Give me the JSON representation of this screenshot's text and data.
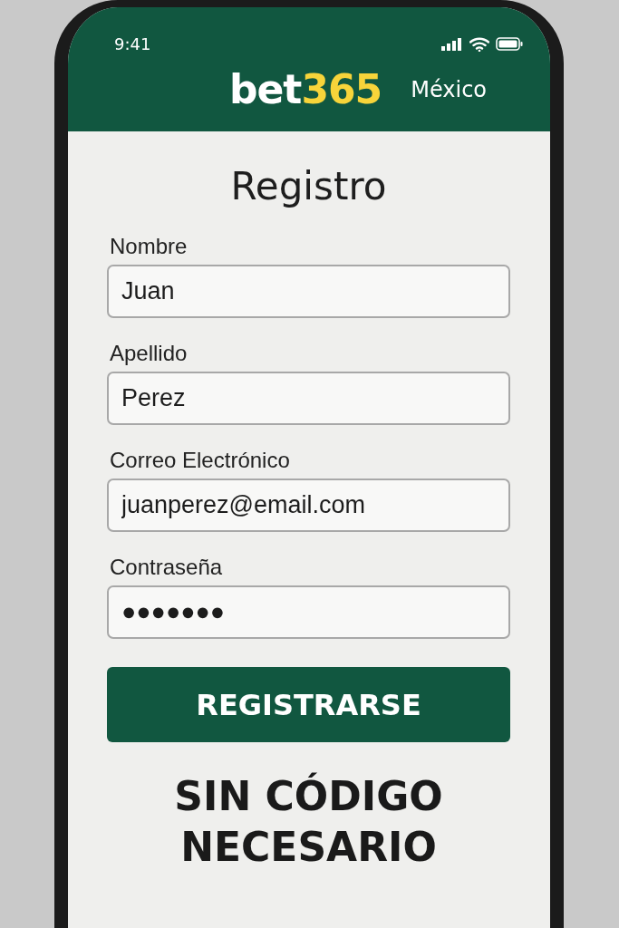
{
  "status_bar": {
    "time": "9:41"
  },
  "header": {
    "logo": {
      "main": "bet",
      "accent": "365"
    },
    "region": "México"
  },
  "form": {
    "title": "Registro",
    "fields": [
      {
        "label": "Nombre",
        "value": "Juan"
      },
      {
        "label": "Apellido",
        "value": "Perez"
      },
      {
        "label": "Correo Electrónico",
        "value": "juanperez@email.com"
      },
      {
        "label": "Contraseña",
        "value": "●●●●●●●"
      }
    ],
    "submit": "REGISTRARSE"
  },
  "tagline": "SIN CÓDIGO NECESARIO"
}
